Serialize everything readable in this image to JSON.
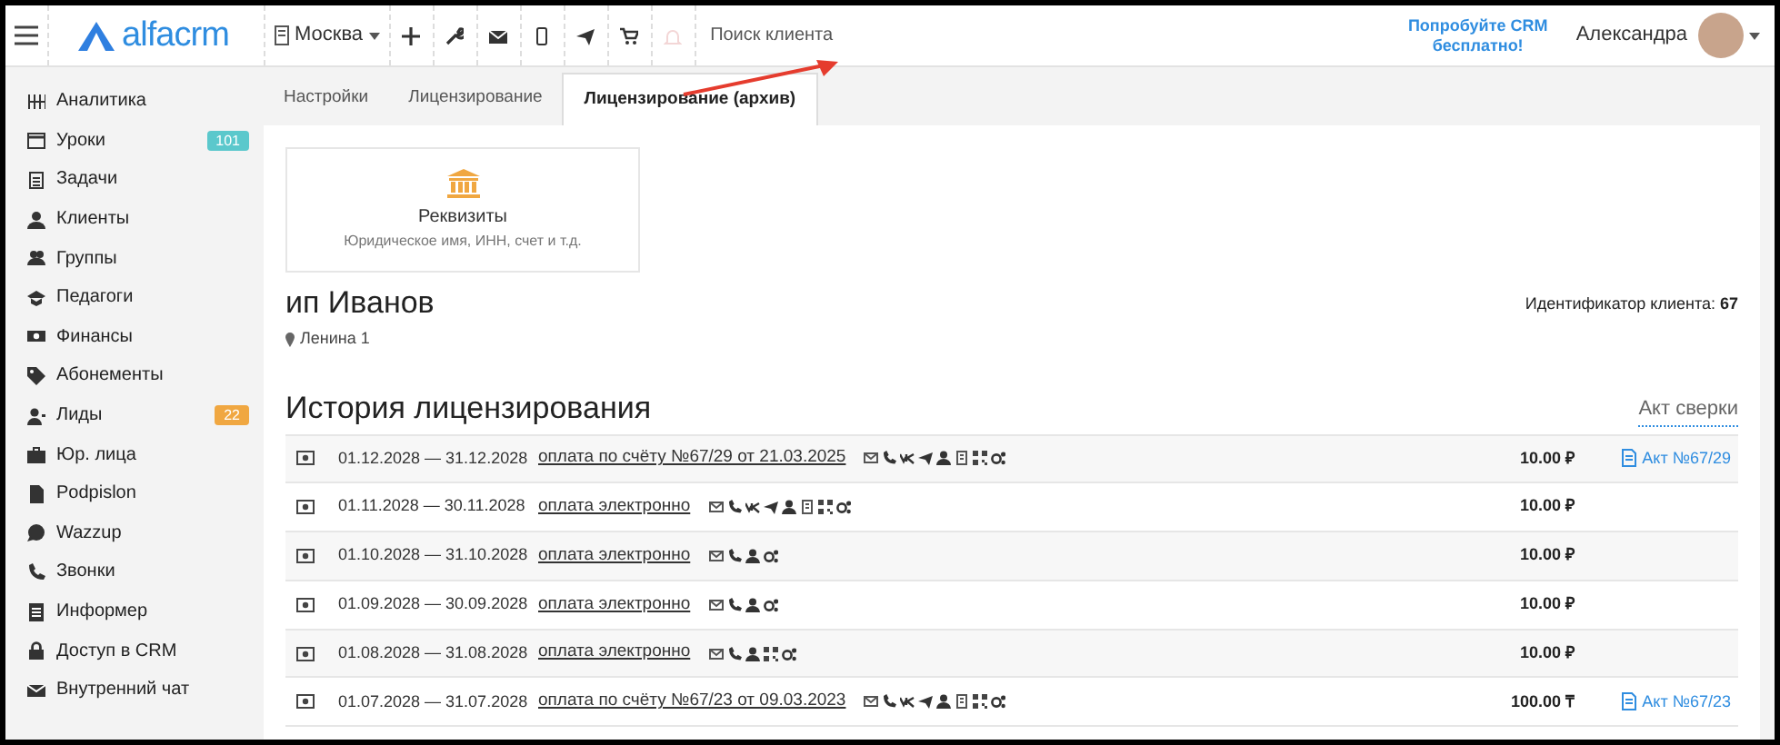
{
  "header": {
    "logo": "alfacrm",
    "city": "Москва",
    "search": {
      "placeholder": "Поиск клиента"
    },
    "promo": "Попробуйте CRM бесплатно!",
    "user": "Александра"
  },
  "sidebar": {
    "items": [
      {
        "label": "Аналитика"
      },
      {
        "label": "Уроки",
        "badge": "101",
        "color": "#5bc8cc"
      },
      {
        "label": "Задачи"
      },
      {
        "label": "Клиенты"
      },
      {
        "label": "Группы"
      },
      {
        "label": "Педагоги"
      },
      {
        "label": "Финансы"
      },
      {
        "label": "Абонементы"
      },
      {
        "label": "Лиды",
        "badge": "22",
        "color": "#f0a741"
      },
      {
        "label": "Юр. лица"
      },
      {
        "label": "Podpislon"
      },
      {
        "label": "Wazzup"
      },
      {
        "label": "Звонки"
      },
      {
        "label": "Информер"
      },
      {
        "label": "Доступ в CRM"
      },
      {
        "label": "Внутренний чат"
      }
    ]
  },
  "tabs": [
    {
      "label": "Настройки",
      "selected": false
    },
    {
      "label": "Лицензирование",
      "selected": false
    },
    {
      "label": "Лицензирование (архив)",
      "selected": true
    }
  ],
  "card": {
    "title": "Реквизиты",
    "subtitle": "Юридическое имя, ИНН, счет и т.д."
  },
  "client": {
    "name": "ип Иванов",
    "address": "Ленина 1",
    "id_label": "Идентификатор клиента:",
    "id_value": "67"
  },
  "history": {
    "title": "История лицензирования",
    "reconcile_link": "Акт сверки",
    "rows": [
      {
        "period": "01.12.2028 — 31.12.2028",
        "payment": "оплата по счёту №67/29 от 21.03.2025",
        "channels": [
          {
            "kind": "mail"
          },
          {
            "kind": "phone"
          },
          {
            "kind": "vk"
          },
          {
            "kind": "telegram"
          },
          {
            "kind": "user"
          },
          {
            "kind": "building"
          },
          {
            "kind": "qr"
          },
          {
            "kind": "gears"
          }
        ],
        "amount": "10.00 ₽",
        "act": "Акт №67/29"
      },
      {
        "period": "01.11.2028 — 30.11.2028",
        "payment": "оплата электронно",
        "channels": [
          {
            "kind": "mail"
          },
          {
            "kind": "phone"
          },
          {
            "kind": "vk"
          },
          {
            "kind": "telegram"
          },
          {
            "kind": "user"
          },
          {
            "kind": "building"
          },
          {
            "kind": "qr"
          },
          {
            "kind": "gears"
          }
        ],
        "amount": "10.00 ₽"
      },
      {
        "period": "01.10.2028 — 31.10.2028",
        "payment": "оплата электронно",
        "channels": [
          {
            "kind": "mail"
          },
          {
            "kind": "phone"
          },
          {
            "kind": "user"
          },
          {
            "kind": "gears"
          }
        ],
        "amount": "10.00 ₽"
      },
      {
        "period": "01.09.2028 — 30.09.2028",
        "payment": "оплата электронно",
        "channels": [
          {
            "kind": "mail"
          },
          {
            "kind": "phone"
          },
          {
            "kind": "user"
          },
          {
            "kind": "gears"
          }
        ],
        "amount": "10.00 ₽"
      },
      {
        "period": "01.08.2028 — 31.08.2028",
        "payment": "оплата электронно",
        "channels": [
          {
            "kind": "mail"
          },
          {
            "kind": "phone"
          },
          {
            "kind": "user"
          },
          {
            "kind": "qr"
          },
          {
            "kind": "gears"
          }
        ],
        "amount": "10.00 ₽"
      },
      {
        "period": "01.07.2028 — 31.07.2028",
        "payment": "оплата по счёту №67/23 от 09.03.2023",
        "channels": [
          {
            "kind": "mail"
          },
          {
            "kind": "phone"
          },
          {
            "kind": "vk"
          },
          {
            "kind": "telegram"
          },
          {
            "kind": "user"
          },
          {
            "kind": "building"
          },
          {
            "kind": "qr"
          },
          {
            "kind": "gears"
          }
        ],
        "amount": "100.00 ₸",
        "act": "Акт №67/23"
      }
    ]
  }
}
